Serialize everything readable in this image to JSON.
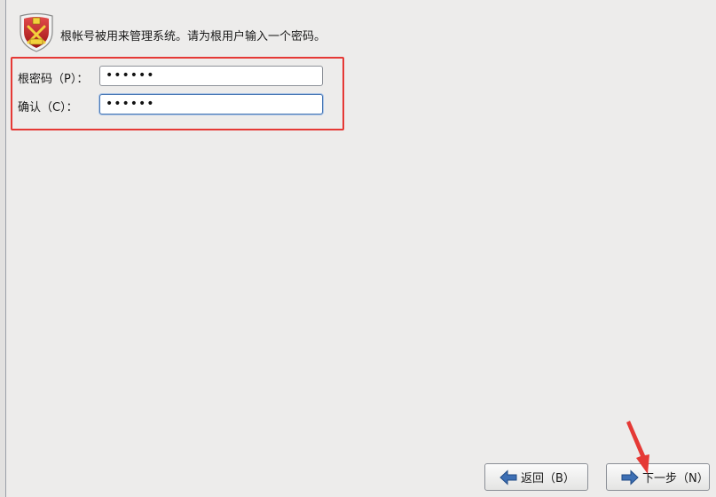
{
  "header": {
    "description": "根帐号被用来管理系统。请为根用户输入一个密码。"
  },
  "form": {
    "root_password": {
      "label": "根密码（P）：",
      "value": "••••••"
    },
    "confirm_password": {
      "label": "确认（C）：",
      "value": "••••••"
    }
  },
  "buttons": {
    "back_label": "返回（B）",
    "next_label": "下一步（N）"
  },
  "colors": {
    "background": "#edeceb",
    "annotation": "#e53935",
    "arrow_icon": "#3d6fb4"
  },
  "icons": {
    "header": "shield-emblem-icon",
    "back": "arrow-left-icon",
    "next": "arrow-right-icon"
  }
}
